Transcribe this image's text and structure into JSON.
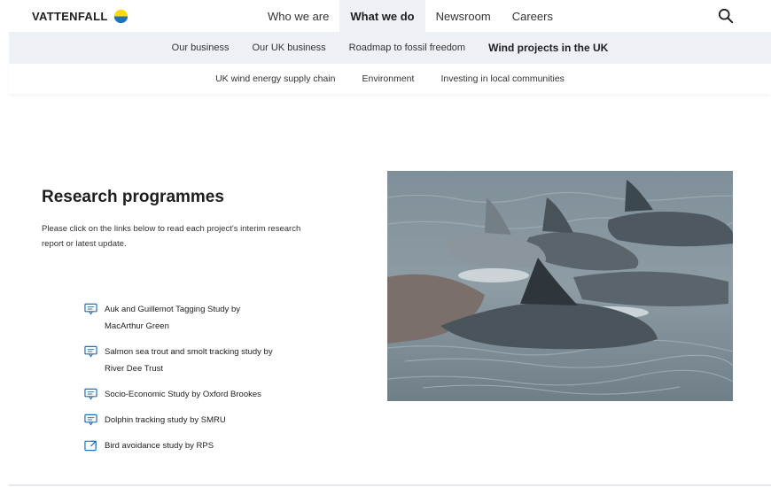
{
  "brand": {
    "name": "VATTENFALL",
    "logo_icon": "vattenfall-logo-icon",
    "colors": {
      "yellow": "#ffda00",
      "blue": "#2071b5",
      "nav_bg": "#edf1f6"
    }
  },
  "main_nav": {
    "items": [
      {
        "label": "Who we are",
        "active": false
      },
      {
        "label": "What we do",
        "active": true
      },
      {
        "label": "Newsroom",
        "active": false
      },
      {
        "label": "Careers",
        "active": false
      }
    ],
    "search_icon": "search-icon"
  },
  "sub_nav": {
    "items": [
      {
        "label": "Our business",
        "active": false
      },
      {
        "label": "Our UK business",
        "active": false
      },
      {
        "label": "Roadmap to fossil freedom",
        "active": false
      },
      {
        "label": "Wind projects in the UK",
        "active": true
      }
    ]
  },
  "tertiary_nav": {
    "items": [
      {
        "label": "UK wind energy supply chain"
      },
      {
        "label": "Environment"
      },
      {
        "label": "Investing in local communities"
      }
    ]
  },
  "content": {
    "heading": "Research programmes",
    "intro": "Please click on the links below to read each project's interim research report or latest update.",
    "links": [
      {
        "label": "Auk and Guillemot Tagging Study by MacArthur Green",
        "icon": "document-icon"
      },
      {
        "label": "Salmon sea trout and smolt tracking study by River Dee Trust",
        "icon": "document-icon"
      },
      {
        "label": "Socio-Economic Study by Oxford Brookes",
        "icon": "document-icon"
      },
      {
        "label": "Dolphin tracking study by SMRU",
        "icon": "document-icon"
      },
      {
        "label": "Bird avoidance study by RPS",
        "icon": "external-link-icon"
      }
    ]
  },
  "image": {
    "subject": "dolphins-photo"
  }
}
